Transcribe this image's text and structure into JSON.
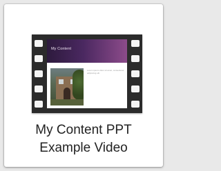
{
  "item": {
    "label_line1": "My Content PPT",
    "label_line2": "Example Video",
    "icon": "video-file-icon"
  },
  "thumbnail": {
    "slide_title": "My Content",
    "slide_body": "Lorem ipsum dolor sit amet, consectetur adipiscing elit."
  },
  "colors": {
    "film": "#2b2b2b",
    "slide_header_start": "#2d1a3d",
    "slide_header_end": "#8c4b8a",
    "label": "#222222"
  }
}
